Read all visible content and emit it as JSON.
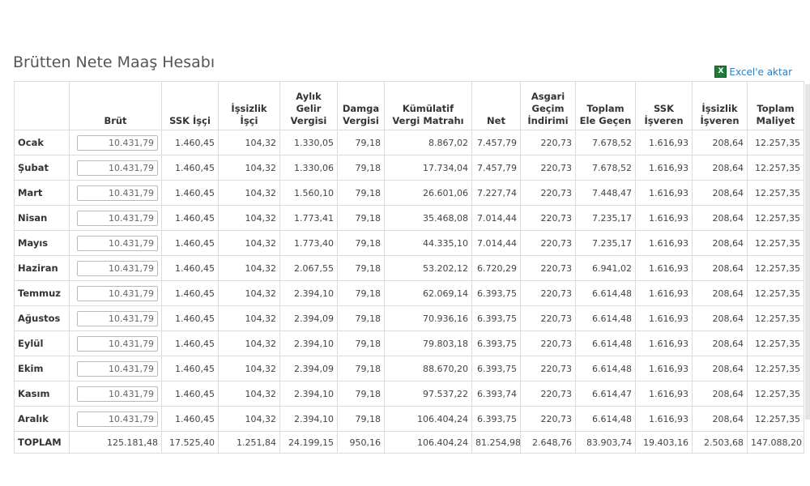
{
  "page": {
    "title": "Brütten Nete Maaş Hesabı",
    "excel_link": "Excel'e aktar",
    "excel_icon": "excel-icon"
  },
  "table": {
    "headers": [
      "",
      "Brüt",
      "SSK İşçi",
      "İşsizlik İşçi",
      "Aylık Gelir Vergisi",
      "Damga Vergisi",
      "Kümülatif Vergi Matrahı",
      "Net",
      "Asgari Geçim İndirimi",
      "Toplam Ele Geçen",
      "SSK İşveren",
      "İşsizlik İşveren",
      "Toplam Maliyet"
    ],
    "rows": [
      {
        "month": "Ocak",
        "gross": "10.431,79",
        "cells": [
          "1.460,45",
          "104,32",
          "1.330,05",
          "79,18",
          "8.867,02",
          "7.457,79",
          "220,73",
          "7.678,52",
          "1.616,93",
          "208,64",
          "12.257,35"
        ]
      },
      {
        "month": "Şubat",
        "gross": "10.431,79",
        "cells": [
          "1.460,45",
          "104,32",
          "1.330,06",
          "79,18",
          "17.734,04",
          "7.457,79",
          "220,73",
          "7.678,52",
          "1.616,93",
          "208,64",
          "12.257,35"
        ]
      },
      {
        "month": "Mart",
        "gross": "10.431,79",
        "cells": [
          "1.460,45",
          "104,32",
          "1.560,10",
          "79,18",
          "26.601,06",
          "7.227,74",
          "220,73",
          "7.448,47",
          "1.616,93",
          "208,64",
          "12.257,35"
        ]
      },
      {
        "month": "Nisan",
        "gross": "10.431,79",
        "cells": [
          "1.460,45",
          "104,32",
          "1.773,41",
          "79,18",
          "35.468,08",
          "7.014,44",
          "220,73",
          "7.235,17",
          "1.616,93",
          "208,64",
          "12.257,35"
        ]
      },
      {
        "month": "Mayıs",
        "gross": "10.431,79",
        "cells": [
          "1.460,45",
          "104,32",
          "1.773,40",
          "79,18",
          "44.335,10",
          "7.014,44",
          "220,73",
          "7.235,17",
          "1.616,93",
          "208,64",
          "12.257,35"
        ]
      },
      {
        "month": "Haziran",
        "gross": "10.431,79",
        "cells": [
          "1.460,45",
          "104,32",
          "2.067,55",
          "79,18",
          "53.202,12",
          "6.720,29",
          "220,73",
          "6.941,02",
          "1.616,93",
          "208,64",
          "12.257,35"
        ]
      },
      {
        "month": "Temmuz",
        "gross": "10.431,79",
        "cells": [
          "1.460,45",
          "104,32",
          "2.394,10",
          "79,18",
          "62.069,14",
          "6.393,75",
          "220,73",
          "6.614,48",
          "1.616,93",
          "208,64",
          "12.257,35"
        ]
      },
      {
        "month": "Ağustos",
        "gross": "10.431,79",
        "cells": [
          "1.460,45",
          "104,32",
          "2.394,09",
          "79,18",
          "70.936,16",
          "6.393,75",
          "220,73",
          "6.614,48",
          "1.616,93",
          "208,64",
          "12.257,35"
        ]
      },
      {
        "month": "Eylül",
        "gross": "10.431,79",
        "cells": [
          "1.460,45",
          "104,32",
          "2.394,10",
          "79,18",
          "79.803,18",
          "6.393,75",
          "220,73",
          "6.614,48",
          "1.616,93",
          "208,64",
          "12.257,35"
        ]
      },
      {
        "month": "Ekim",
        "gross": "10.431,79",
        "cells": [
          "1.460,45",
          "104,32",
          "2.394,09",
          "79,18",
          "88.670,20",
          "6.393,75",
          "220,73",
          "6.614,48",
          "1.616,93",
          "208,64",
          "12.257,35"
        ]
      },
      {
        "month": "Kasım",
        "gross": "10.431,79",
        "cells": [
          "1.460,45",
          "104,32",
          "2.394,10",
          "79,18",
          "97.537,22",
          "6.393,74",
          "220,73",
          "6.614,47",
          "1.616,93",
          "208,64",
          "12.257,35"
        ]
      },
      {
        "month": "Aralık",
        "gross": "10.431,79",
        "cells": [
          "1.460,45",
          "104,32",
          "2.394,10",
          "79,18",
          "106.404,24",
          "6.393,75",
          "220,73",
          "6.614,48",
          "1.616,93",
          "208,64",
          "12.257,35"
        ]
      }
    ],
    "total": {
      "label": "TOPLAM",
      "cells": [
        "125.181,48",
        "17.525,40",
        "1.251,84",
        "24.199,15",
        "950,16",
        "106.404,24",
        "81.254,98",
        "2.648,76",
        "83.903,74",
        "19.403,16",
        "2.503,68",
        "147.088,20"
      ]
    }
  }
}
